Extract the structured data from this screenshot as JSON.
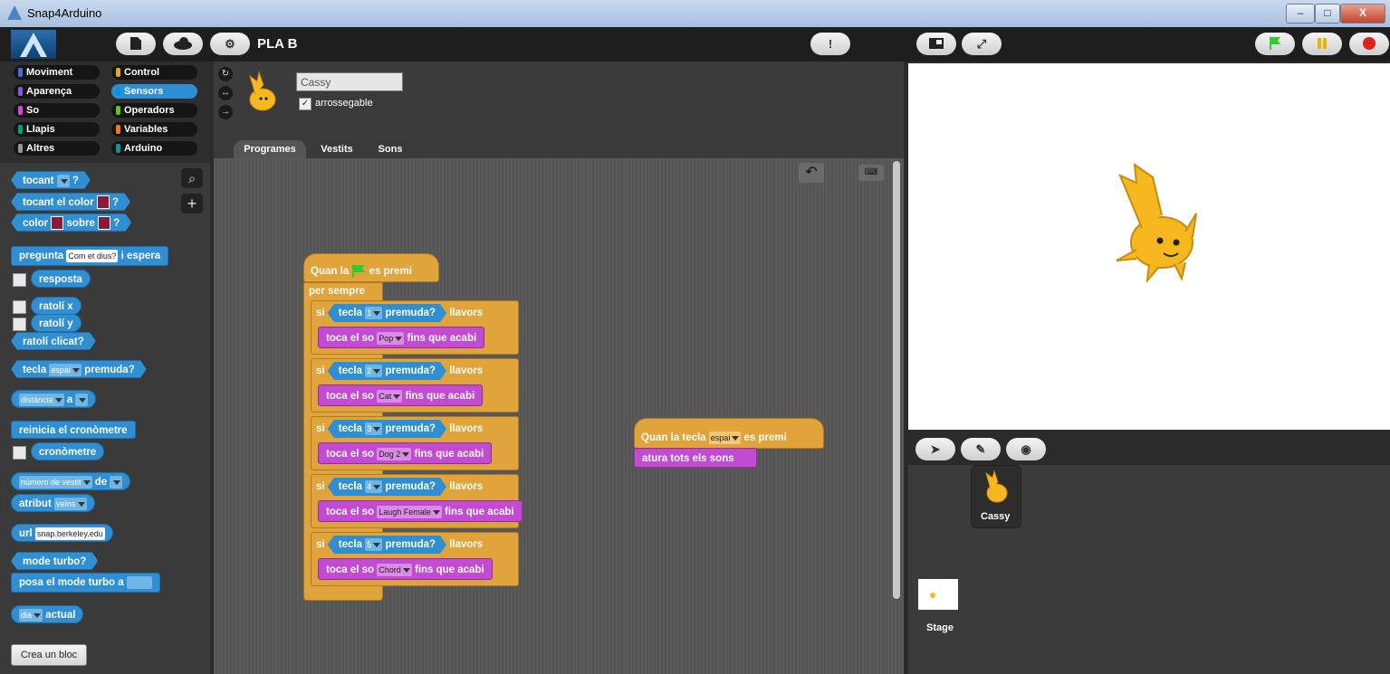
{
  "window": {
    "title": "Snap4Arduino",
    "minimize": "–",
    "maximize": "□",
    "close": "X"
  },
  "toolbar": {
    "project_name": "PLA B"
  },
  "categories": [
    {
      "label": "Moviment",
      "color": "#4a6cd4"
    },
    {
      "label": "Control",
      "color": "#e6a822"
    },
    {
      "label": "Aparença",
      "color": "#8a55d7"
    },
    {
      "label": "Sensors",
      "color": "#0093d6",
      "selected": true
    },
    {
      "label": "So",
      "color": "#cf4ad9"
    },
    {
      "label": "Operadors",
      "color": "#62c213"
    },
    {
      "label": "Llapis",
      "color": "#00a178"
    },
    {
      "label": "Variables",
      "color": "#f3761d"
    },
    {
      "label": "Altres",
      "color": "#969696"
    },
    {
      "label": "Arduino",
      "color": "#00979c"
    }
  ],
  "palette": {
    "touching": "tocant",
    "q": "?",
    "touching_color": "tocant el color",
    "color": "color",
    "over": "sobre",
    "ask": "pregunta",
    "ask_default": "Com et dius?",
    "and_wait": "i espera",
    "answer": "resposta",
    "mouse_x": "ratolí x",
    "mouse_y": "ratolí y",
    "mouse_down": "ratolí clicat?",
    "key": "tecla",
    "key_space": "espai",
    "pressed": "premuda?",
    "distance": "distància",
    "to": "a",
    "reset_timer": "reinicia el cronòmetre",
    "timer": "cronòmetre",
    "costume_num": "número de vestit",
    "of": "de",
    "attribute": "atribut",
    "neighbors": "veïns",
    "url": "url",
    "url_value": "snap.berkeley.edu",
    "turbo": "mode turbo?",
    "set_turbo": "posa el mode turbo a",
    "day": "dia",
    "current": "actual",
    "make_block": "Crea un bloc"
  },
  "sprite": {
    "name": "Cassy",
    "draggable": "arrossegable",
    "check": "✓"
  },
  "tabs": [
    "Programes",
    "Vestits",
    "Sons"
  ],
  "script1": {
    "hat_pre": "Quan la",
    "hat_post": "es premi",
    "forever": "per sempre",
    "if": "si",
    "then": "llavors",
    "key": "tecla",
    "pressed": "premuda?",
    "play": "toca el so",
    "until_done": "fins que acabi",
    "branches": [
      {
        "key": "1",
        "sound": "Pop"
      },
      {
        "key": "2",
        "sound": "Cat"
      },
      {
        "key": "3",
        "sound": "Dog 2"
      },
      {
        "key": "4",
        "sound": "Laugh Female"
      },
      {
        "key": "5",
        "sound": "Chord"
      }
    ]
  },
  "script2": {
    "hat_pre": "Quan la tecla",
    "key": "espai",
    "hat_post": "es premi",
    "stop": "atura tots els sons"
  },
  "corral": {
    "sprite_label": "Cassy",
    "stage_label": "Stage"
  },
  "colors": {
    "sensors": "#2f8fd2",
    "sound": "#c34bd4",
    "control": "#e0a43a",
    "flag_green": "#2ecc2e"
  }
}
